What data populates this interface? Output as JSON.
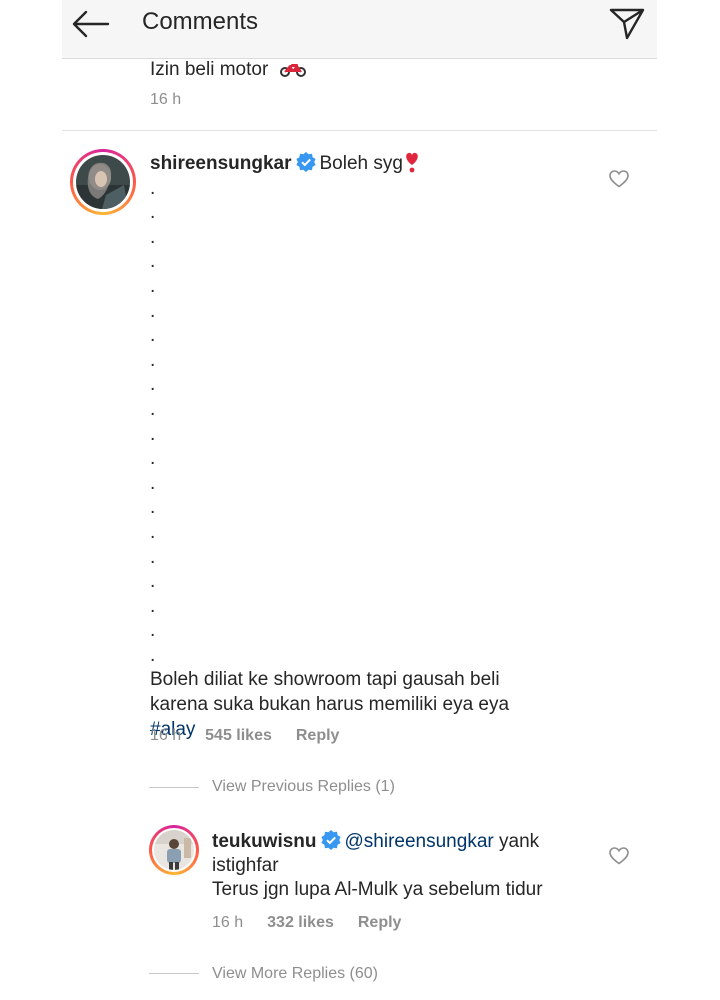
{
  "header": {
    "title": "Comments"
  },
  "previous_comment": {
    "text": "Izin beli motor",
    "time": "16 h"
  },
  "comment": {
    "username": "shireensungkar",
    "first_line": "Boleh syg",
    "dots": [
      ".",
      ".",
      ".",
      ".",
      ".",
      ".",
      ".",
      ".",
      ".",
      ".",
      ".",
      ".",
      ".",
      ".",
      ".",
      ".",
      ".",
      ".",
      ".",
      "."
    ],
    "body_line1": "Boleh diliat ke showroom tapi gausah beli",
    "body_line2": "karena suka bukan harus memiliki eya eya",
    "hashtag": "#alay",
    "time": "16 h",
    "likes": "545 likes",
    "reply": "Reply"
  },
  "view_previous": "View Previous Replies (1)",
  "reply_comment": {
    "username": "teukuwisnu",
    "mention": "@shireensungkar",
    "text_line1": " yank",
    "text_line2": "istighfar",
    "text_line3": "Terus jgn lupa Al-Mulk ya sebelum tidur",
    "time": "16 h",
    "likes": "332 likes",
    "reply": "Reply"
  },
  "view_more": "View More Replies (60)",
  "colors": {
    "link": "#003569",
    "verified": "#3897f0",
    "meta": "#8e8e8e",
    "text": "#262626"
  }
}
